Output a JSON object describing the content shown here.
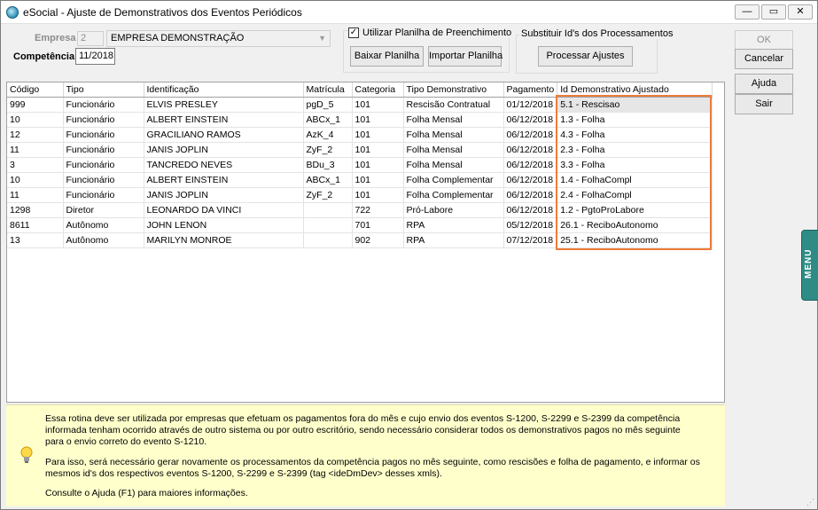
{
  "window": {
    "title": "eSocial - Ajuste de Demonstrativos dos Eventos Periódicos",
    "min_glyph": "—",
    "max_glyph": "▭",
    "close_glyph": "✕"
  },
  "empresa": {
    "label": "Empresa",
    "code": "2",
    "name": "EMPRESA DEMONSTRAÇÃO"
  },
  "competencia": {
    "label": "Competência",
    "value": "11/2018"
  },
  "planilha": {
    "checkbox_label": "Utilizar Planilha de Preenchimento",
    "checked": true,
    "check_glyph": "✓",
    "baixar_label": "Baixar Planilha",
    "importar_label": "Importar Planilha"
  },
  "substituir": {
    "group_label": "Substituir Id's dos Processamentos",
    "button_label": "Processar Ajustes"
  },
  "side_buttons": {
    "ok": "OK",
    "cancelar": "Cancelar",
    "ajuda": "Ajuda",
    "sair": "Sair"
  },
  "table": {
    "columns": [
      "Código",
      "Tipo",
      "Identificação",
      "Matrícula",
      "Categoria",
      "Tipo Demonstrativo",
      "Pagamento",
      "Id Demonstrativo Ajustado"
    ],
    "rows": [
      [
        "999",
        "Funcionário",
        "ELVIS PRESLEY",
        "pgD_5",
        "101",
        "Rescisão Contratual",
        "01/12/2018",
        "5.1 - Rescisao"
      ],
      [
        "10",
        "Funcionário",
        "ALBERT EINSTEIN",
        "ABCx_1",
        "101",
        "Folha Mensal",
        "06/12/2018",
        "1.3 - Folha"
      ],
      [
        "12",
        "Funcionário",
        "GRACILIANO RAMOS",
        "AzK_4",
        "101",
        "Folha Mensal",
        "06/12/2018",
        "4.3 - Folha"
      ],
      [
        "11",
        "Funcionário",
        "JANIS JOPLIN",
        "ZyF_2",
        "101",
        "Folha Mensal",
        "06/12/2018",
        "2.3 - Folha"
      ],
      [
        "3",
        "Funcionário",
        "TANCREDO NEVES",
        "BDu_3",
        "101",
        "Folha Mensal",
        "06/12/2018",
        "3.3 - Folha"
      ],
      [
        "10",
        "Funcionário",
        "ALBERT EINSTEIN",
        "ABCx_1",
        "101",
        "Folha Complementar",
        "06/12/2018",
        "1.4 - FolhaCompl"
      ],
      [
        "11",
        "Funcionário",
        "JANIS JOPLIN",
        "ZyF_2",
        "101",
        "Folha Complementar",
        "06/12/2018",
        "2.4 - FolhaCompl"
      ],
      [
        "1298",
        "Diretor",
        "LEONARDO DA VINCI",
        "",
        "722",
        "Pró-Labore",
        "06/12/2018",
        "1.2 - PgtoProLabore"
      ],
      [
        "8611",
        "Autônomo",
        "JOHN LENON",
        "",
        "701",
        "RPA",
        "05/12/2018",
        "26.1 - ReciboAutonomo"
      ],
      [
        "13",
        "Autônomo",
        "MARILYN MONROE",
        "",
        "902",
        "RPA",
        "07/12/2018",
        "25.1 - ReciboAutonomo"
      ]
    ],
    "selected_row": 0
  },
  "info": {
    "p1": "Essa rotina deve ser utilizada por empresas que efetuam os pagamentos fora do mês e cujo envio dos eventos S-1200, S-2299 e S-2399 da competência informada tenham ocorrido através de outro sistema ou por outro escritório, sendo necessário considerar todos os demonstrativos pagos no mês seguinte para o envio correto do evento S-1210.",
    "p2": "Para isso, será necessário gerar novamente os processamentos da competência pagos no mês seguinte, como rescisões e folha de pagamento, e informar os mesmos id's dos respectivos eventos S-1200, S-2299 e S-2399 (tag <ideDmDev> desses xmls).",
    "p3": "Consulte o Ajuda (F1) para maiores informações."
  },
  "side_tab": {
    "label": "MENU"
  },
  "colors": {
    "highlight": "#ee7c3a",
    "info_bg": "#ffffcc",
    "menu_tab": "#2e8b86"
  },
  "icons": [
    "app-icon",
    "chevron-down-icon",
    "lightbulb-icon",
    "resize-grip-icon"
  ]
}
